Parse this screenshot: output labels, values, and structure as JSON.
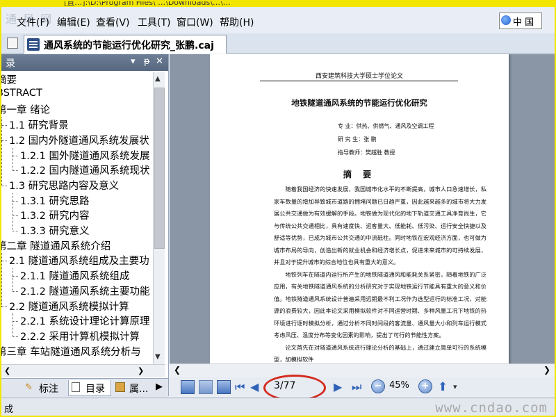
{
  "window": {
    "title_strip_text": "[直…]:\\D:\\Program Files\\ …\\Downloads\\…\\…",
    "watermark_top": "通 风 网"
  },
  "menu": [
    "文件(F)",
    "编辑(E)",
    "查看(V)",
    "工具(T)",
    "窗口(W)",
    "帮助(H)"
  ],
  "language": "中 国",
  "tab": {
    "label": "通风系统的节能运行优化研究_张鹏.caj"
  },
  "sidebar": {
    "header": "录",
    "header_buttons": [
      "▾",
      "ᵽ",
      "✕"
    ],
    "toc": [
      {
        "text": "摘要",
        "level": 0
      },
      {
        "text": "BSTRACT",
        "level": 0
      },
      {
        "text": "第一章 绪论",
        "level": 0
      },
      {
        "text": "1.1 研究背景",
        "level": 1
      },
      {
        "text": "1.2 国内外隧道通风系统发展状",
        "level": 1
      },
      {
        "text": "1.2.1 国外隧道通风系统发展",
        "level": 2
      },
      {
        "text": "1.2.2 国内隧道通风系统现状",
        "level": 2
      },
      {
        "text": "1.3 研究思路内容及意义",
        "level": 1
      },
      {
        "text": "1.3.1 研究思路",
        "level": 2
      },
      {
        "text": "1.3.2 研究内容",
        "level": 2
      },
      {
        "text": "1.3.3 研究意义",
        "level": 2
      },
      {
        "text": "第二章 隧道通风系统介绍",
        "level": 0
      },
      {
        "text": "2.1 隧道通风系统组成及主要功",
        "level": 1
      },
      {
        "text": "2.1.1 隧道通风系统组成",
        "level": 2
      },
      {
        "text": "2.1.2 隧道通风系统主要功能",
        "level": 2
      },
      {
        "text": "2.2 隧道通风系统模拟计算",
        "level": 1
      },
      {
        "text": "2.2.1 系统设计理论计算原理",
        "level": 2
      },
      {
        "text": "2.2.2 采用计算机模拟计算",
        "level": 2
      },
      {
        "text": "第三章 车站隧道通风系统分析与",
        "level": 0
      }
    ],
    "tabs": [
      {
        "label": "标注",
        "icon": "pen-icon"
      },
      {
        "label": "目录",
        "icon": "list-icon"
      },
      {
        "label": "属...",
        "icon": "properties-icon"
      }
    ]
  },
  "document": {
    "header": "西安建筑科技大学硕士学位论文",
    "title": "地铁隧道通风系统的节能运行优化研究",
    "meta": [
      "专      业：供热、供燃气、通风及空调工程",
      "研  究  生：张    鹏",
      "指导教师：樊越胜    教授"
    ],
    "abstract_heading": "摘  要",
    "paragraphs": [
      "随着我国经济的快速发展，我国城市化水平的不断提高，城市人口急速增长，私家车数量的增加导致城市道路的拥堵问题已日趋严重，因此越来越多的城市将大力发展公共交通做为有效缓解的手段。地铁做为现代化的地下轨道交通工具净育尚生，它与传统公共交通相比，具有速度快、运客量大、低能耗、低污染、运行安全快捷以及舒适等优势，已成为城市公共交通的中流砥柱。同时地铁在宏观经济方面，也可做为城市布局的导向，创造出新的就业机会和经济增长点，促进未来城市的可持续发展，并且对于提升城市的综合地位也具有重大的意义。",
      "地铁列车在隧道内运行所产生的地铁隧道通风和能耗关系紧密，随着地铁的广泛应用，有关地铁隧道通风系统的分析研究对于实现地铁运行节能具有重大的意义和价值。地铁隧道通风系统设计普遍采用远期最不利工况作为选型运行的标准工况，对能源的浪费较大，因此本论文采用模拟软件对不同运营时期、多种风量工况下地铁的热环境进行逐时模拟分析，通过分析不同时间段的客流量、通风量大小和列车运行模式考虑风压、温度分布等变化因素的影响，提出了可行的节能性方案。",
      "论文首先在对隧道通风系统进行理论分析的基础上，通过建立简单可行的系统模型，加模拟软件"
    ]
  },
  "navigation": {
    "page_display": "3/77",
    "zoom": "45%"
  },
  "status": {
    "left": "成",
    "watermark": "www.cndao.com"
  }
}
